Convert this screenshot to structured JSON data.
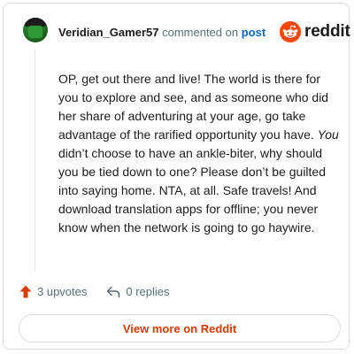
{
  "comment": {
    "username": "Veridian_Gamer57",
    "action_text": "commented on",
    "target_text": "post",
    "body_segments": [
      {
        "text": "OP, get out there and live! The world is there for you to explore and see, and as someone who did her share of adventuring at your age, go take advantage of the rarified opportunity you have. ",
        "italic": false
      },
      {
        "text": "You",
        "italic": true
      },
      {
        "text": " didn’t choose to have an ankle-biter, why should you be tied down to one? Please don’t be guilted into saying home. NTA, at all. Safe travels! And download translation apps for offline; you never know when the network is going to go haywire.",
        "italic": false
      }
    ]
  },
  "brand": {
    "name": "reddit",
    "icon": "reddit-snoo-icon",
    "color": "#ff4500"
  },
  "actions": {
    "upvotes_label": "3 upvotes",
    "replies_label": "0 replies",
    "upvote_icon": "upvote-arrow-icon",
    "reply_icon": "reply-arrow-icon"
  },
  "footer": {
    "view_more_label": "View more on Reddit"
  },
  "colors": {
    "accent": "#d93a00",
    "link": "#0a66c2",
    "muted": "#576f76",
    "text": "#1c1c1c"
  }
}
